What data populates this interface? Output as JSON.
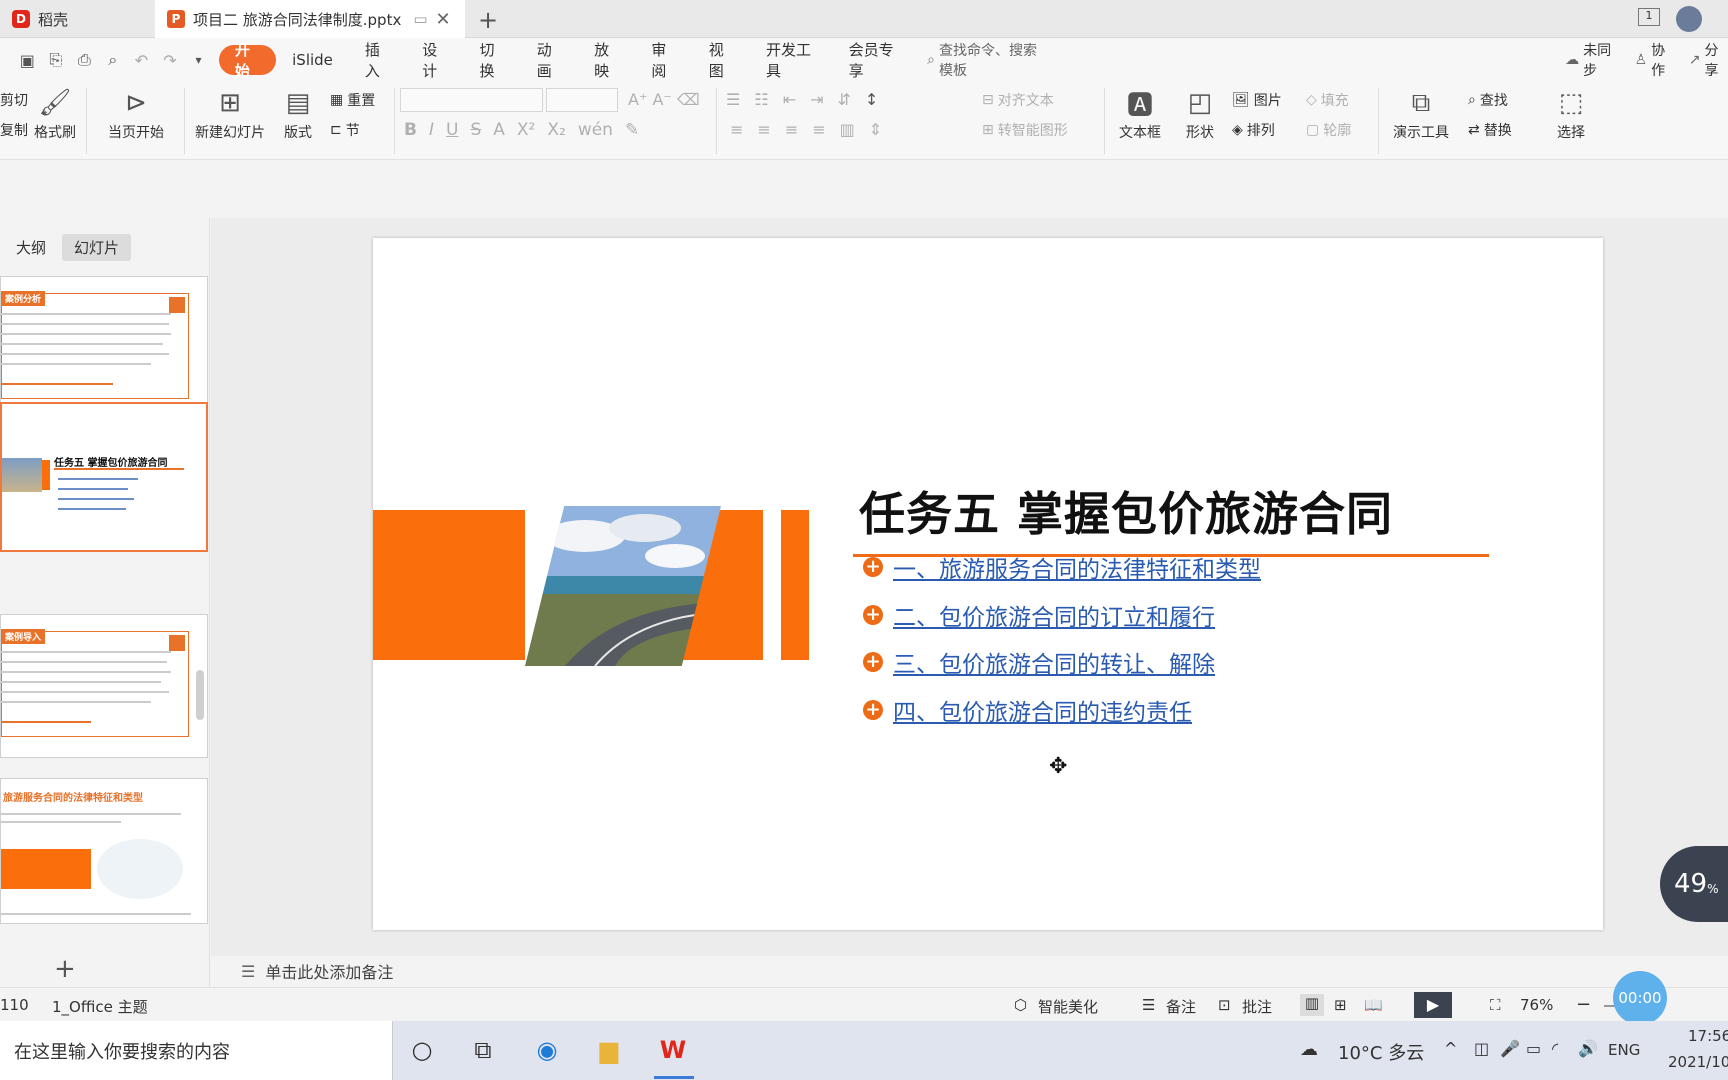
{
  "tabs": [
    {
      "label": "稻壳"
    },
    {
      "label": "项目二 旅游合同法律制度.pptx"
    }
  ],
  "menu": {
    "items": [
      "开始",
      "iSlide",
      "插入",
      "设计",
      "切换",
      "动画",
      "放映",
      "审阅",
      "视图",
      "开发工具",
      "会员专享"
    ],
    "search_placeholder": "查找命令、搜索模板",
    "sync": "未同步",
    "collab": "协作",
    "share": "分享"
  },
  "ribbon": {
    "cut": "剪切",
    "copy": "复制",
    "format_painter": "格式刷",
    "play_from_current": "当页开始",
    "new_slide": "新建幻灯片",
    "layout": "版式",
    "reset": "重置",
    "section": "节",
    "align_text": "对齐文本",
    "smart_shape": "转智能图形",
    "textbox": "文本框",
    "shape": "形状",
    "picture": "图片",
    "arrange": "排列",
    "fill": "填充",
    "outline": "轮廓",
    "present_tools": "演示工具",
    "find": "查找",
    "replace": "替换",
    "select": "选择"
  },
  "panel": {
    "outline_tab": "大纲",
    "slides_tab": "幻灯片",
    "thumb1_title": "案例分析",
    "thumb2_title": "任务五 掌握包价旅游合同",
    "thumb3_title": "案例导入",
    "thumb4_title": "旅游服务合同的法律特征和类型"
  },
  "slide": {
    "title": "任务五  掌握包价旅游合同",
    "items": [
      "一、旅游服务合同的法律特征和类型",
      "二、包价旅游合同的订立和履行",
      "三、包价旅游合同的转让、解除",
      "四、包价旅游合同的违约责任"
    ],
    "accent": "#fb6e0c",
    "link_color": "#2a5bb0"
  },
  "notes_placeholder": "单击此处添加备注",
  "status": {
    "slide_num": "110",
    "theme": "1_Office 主题",
    "beautify": "智能美化",
    "notes": "备注",
    "comments": "批注",
    "zoom": "76%",
    "timer": "00:00",
    "progress": "49"
  },
  "taskbar": {
    "search": "在这里输入你要搜索的内容",
    "weather": "10°C  多云",
    "lang": "ENG",
    "time": "17:56",
    "date": "2021/10"
  }
}
